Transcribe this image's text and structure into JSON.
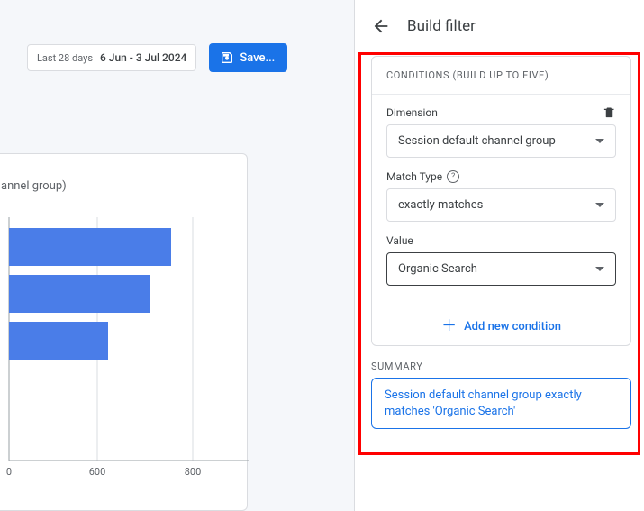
{
  "toolbar": {
    "date_label": "Last 28 days",
    "date_range": "6 Jun - 3 Jul 2024",
    "save_label": "Save..."
  },
  "chart_data": {
    "type": "bar",
    "orientation": "horizontal",
    "title_fragment": "annel group)",
    "series": [
      {
        "name": "",
        "values": [
          750,
          650,
          460
        ]
      }
    ],
    "x_ticks": [
      0,
      600,
      800
    ],
    "x_tick_labels": [
      "0",
      "600",
      "800"
    ],
    "xlim": [
      0,
      1000
    ],
    "bar_color": "#4a7de8"
  },
  "panel": {
    "title": "Build filter",
    "conditions_header": "CONDITIONS (BUILD UP TO FIVE)",
    "dimension_label": "Dimension",
    "dimension_value": "Session default channel group",
    "match_type_label": "Match Type",
    "match_type_value": "exactly matches",
    "value_label": "Value",
    "value_value": "Organic Search",
    "add_condition": "Add new condition",
    "summary_label": "SUMMARY",
    "summary_text": "Session default channel group exactly matches 'Organic Search'"
  }
}
